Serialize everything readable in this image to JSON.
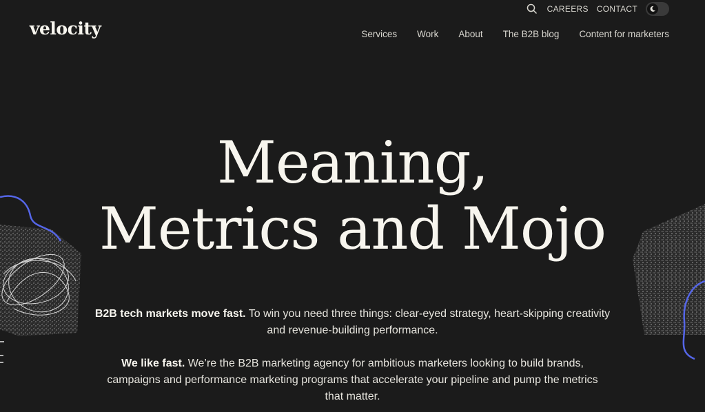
{
  "brand": {
    "logo": "velocity"
  },
  "utility": {
    "careers": "CAREERS",
    "contact": "CONTACT"
  },
  "nav": {
    "items": [
      "Services",
      "Work",
      "About",
      "The B2B blog",
      "Content for marketers"
    ]
  },
  "hero": {
    "line1": "Meaning,",
    "line2": "Metrics and Mojo"
  },
  "intro": {
    "p1_bold": "B2B tech markets move fast.",
    "p1_rest_a": " To win you need three things: clear-eyed strategy, heart-skipping creativity",
    "p1_rest_b": "and revenue-building performance.",
    "p2_bold": "We like fast.",
    "p2_rest_a": " We’re the B2B marketing agency for ambitious marketers looking to build brands,",
    "p2_rest_b": "campaigns and performance marketing programs that accelerate your pipeline and pump the metrics",
    "p2_rest_c": "that matter."
  },
  "colors": {
    "background": "#1b1b1b",
    "text": "#f1efe8",
    "accent_line": "#5566e8"
  },
  "icons": [
    "search-icon",
    "moon-icon"
  ]
}
